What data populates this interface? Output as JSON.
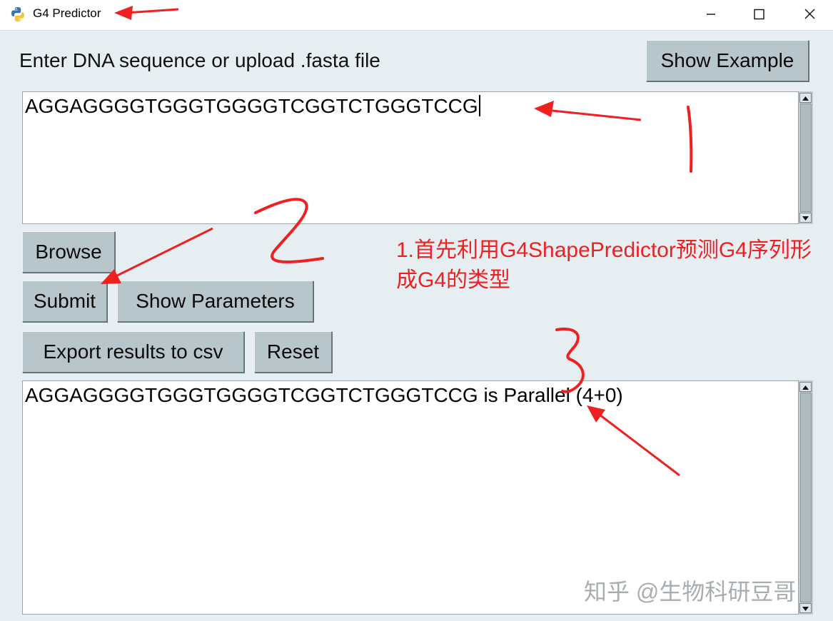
{
  "window": {
    "title": "G4 Predictor",
    "icon": "python-icon",
    "controls": [
      "minimize-icon",
      "maximize-icon",
      "close-icon"
    ]
  },
  "input_section": {
    "label": "Enter DNA sequence or upload .fasta file",
    "show_example_label": "Show Example",
    "sequence_value": "AGGAGGGGTGGGTGGGGTCGGTCTGGGTCCG"
  },
  "buttons": {
    "browse_label": "Browse",
    "submit_label": "Submit",
    "show_parameters_label": "Show Parameters",
    "export_label": "Export results to csv",
    "reset_label": "Reset"
  },
  "output_section": {
    "result_text": "AGGAGGGGTGGGTGGGGTCGGTCTGGGTCCG is Parallel (4+0)"
  },
  "annotations": {
    "note_text": "1.首先利用G4ShapePredictor预测G4序列形成G4的类型",
    "marks": [
      "1",
      "2",
      "3"
    ],
    "color": "#ee2020"
  },
  "watermark": {
    "text": "知乎 @生物科研豆哥"
  },
  "colors": {
    "background": "#e6eef2",
    "button": "#b8c6cc",
    "scrollbar": "#c3cdd1",
    "annotation": "#ee2020"
  }
}
